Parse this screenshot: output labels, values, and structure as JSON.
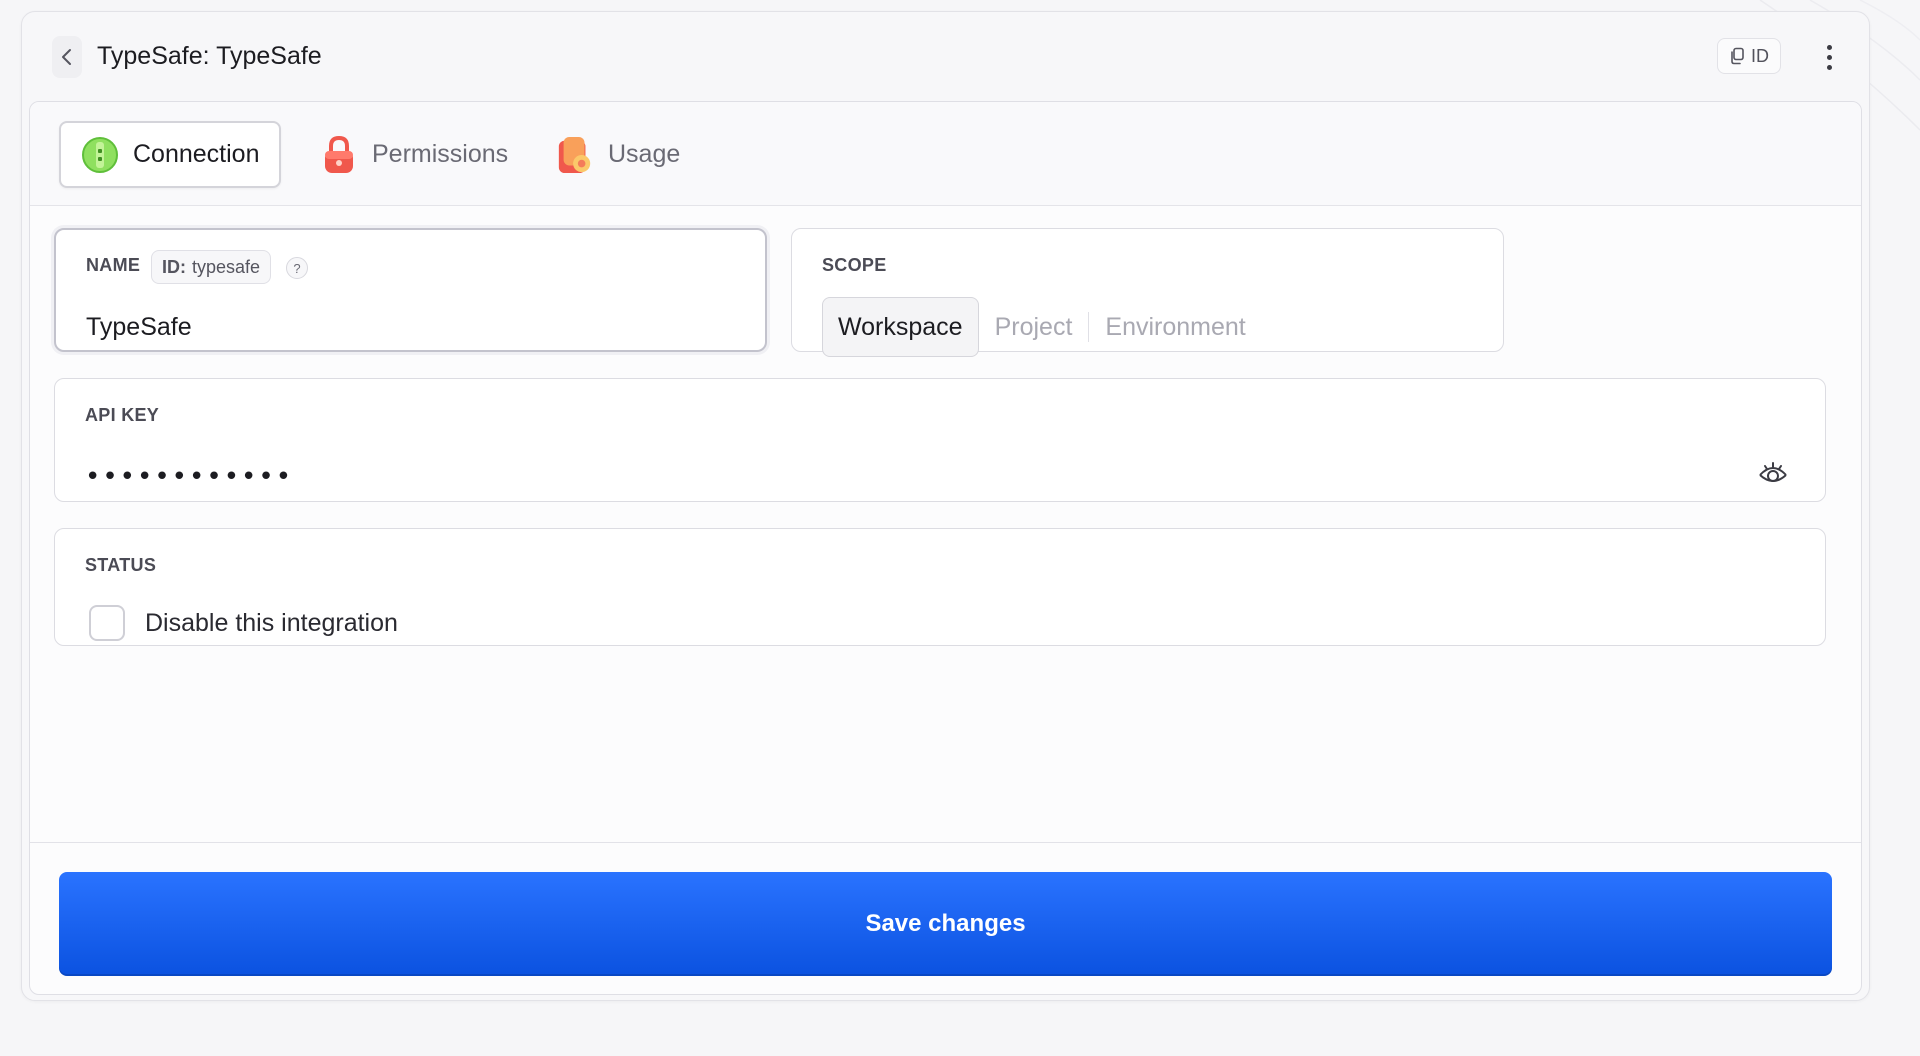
{
  "header": {
    "title": "TypeSafe: TypeSafe",
    "back_icon": "chevron-left-icon",
    "id_button_label": "ID",
    "id_button_icon": "copy-icon",
    "more_icon": "kebab-menu-icon"
  },
  "tabs": [
    {
      "label": "Connection",
      "icon": "connection-icon",
      "active": true
    },
    {
      "label": "Permissions",
      "icon": "lock-icon",
      "active": false
    },
    {
      "label": "Usage",
      "icon": "usage-icon",
      "active": false
    }
  ],
  "name_field": {
    "label": "NAME",
    "id_key": "ID:",
    "id_value": "typesafe",
    "help_glyph": "?",
    "value": "TypeSafe"
  },
  "scope_field": {
    "label": "SCOPE",
    "options": [
      "Workspace",
      "Project",
      "Environment"
    ],
    "selected": "Workspace"
  },
  "api_key_field": {
    "label": "API KEY",
    "masked_value": "••••••••••••",
    "toggle_icon": "eye-icon"
  },
  "status_field": {
    "label": "STATUS",
    "checkbox_label": "Disable this integration",
    "checked": false
  },
  "actions": {
    "save_label": "Save changes"
  },
  "colors": {
    "primary": "#1a63f5",
    "connection_icon": "#7ed957",
    "permissions_icon": "#f0584c",
    "usage_icon": "#f47b5a"
  }
}
